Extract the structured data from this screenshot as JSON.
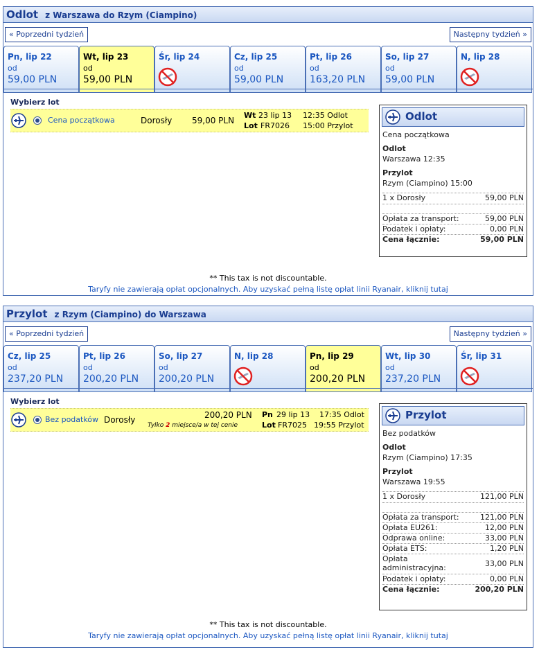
{
  "outbound": {
    "title": "Odlot",
    "route": "z Warszawa do Rzym (Ciampino)",
    "prev_week": "« Poprzedni tydzień",
    "next_week": "Następny tydzień »",
    "days": [
      {
        "name": "Pn, lip 22",
        "od": "od",
        "price": "59,00 PLN",
        "available": true,
        "selected": false
      },
      {
        "name": "Wt, lip 23",
        "od": "od",
        "price": "59,00 PLN",
        "available": true,
        "selected": true
      },
      {
        "name": "Śr, lip 24",
        "od": "",
        "price": "",
        "available": false,
        "selected": false
      },
      {
        "name": "Cz, lip 25",
        "od": "od",
        "price": "59,00 PLN",
        "available": true,
        "selected": false
      },
      {
        "name": "Pt, lip 26",
        "od": "od",
        "price": "163,20 PLN",
        "available": true,
        "selected": false
      },
      {
        "name": "So, lip 27",
        "od": "od",
        "price": "59,00 PLN",
        "available": true,
        "selected": false
      },
      {
        "name": "N, lip 28",
        "od": "",
        "price": "",
        "available": false,
        "selected": false
      }
    ],
    "choose_label": "Wybierz lot",
    "flight": {
      "fare": "Cena początkowa",
      "passenger": "Dorosły",
      "price": "59,00 PLN",
      "day_label": "Wt",
      "date": "23 lip 13",
      "lot_label": "Lot",
      "flight_no": "FR7026",
      "depart": "12:35 Odlot",
      "arrive": "15:00 Przylot"
    },
    "summary": {
      "title": "Odlot",
      "fare": "Cena początkowa",
      "dep_label": "Odlot",
      "dep_value": "Warszawa 12:35",
      "arr_label": "Przylot",
      "arr_value": "Rzym (Ciampino) 15:00",
      "pax": {
        "label": "1 x Dorosły",
        "value": "59,00 PLN"
      },
      "fees": [
        {
          "label": "Opłata za transport:",
          "value": "59,00 PLN"
        },
        {
          "label": "Podatek i opłaty:",
          "value": "0,00 PLN"
        }
      ],
      "total": {
        "label": "Cena łącznie:",
        "value": "59,00 PLN"
      }
    },
    "note": "** This tax is not discountable.",
    "link": "Taryfy nie zawierają opłat opcjonalnych. Aby uzyskać pełną listę opłat linii Ryanair, kliknij tutaj"
  },
  "inbound": {
    "title": "Przylot",
    "route": "z Rzym (Ciampino) do Warszawa",
    "prev_week": "« Poprzedni tydzień",
    "next_week": "Następny tydzień »",
    "days": [
      {
        "name": "Cz, lip 25",
        "od": "od",
        "price": "237,20 PLN",
        "available": true,
        "selected": false
      },
      {
        "name": "Pt, lip 26",
        "od": "od",
        "price": "200,20 PLN",
        "available": true,
        "selected": false
      },
      {
        "name": "So, lip 27",
        "od": "od",
        "price": "200,20 PLN",
        "available": true,
        "selected": false
      },
      {
        "name": "N, lip 28",
        "od": "",
        "price": "",
        "available": false,
        "selected": false
      },
      {
        "name": "Pn, lip 29",
        "od": "od",
        "price": "200,20 PLN",
        "available": true,
        "selected": true
      },
      {
        "name": "Wt, lip 30",
        "od": "od",
        "price": "237,20 PLN",
        "available": true,
        "selected": false
      },
      {
        "name": "Śr, lip 31",
        "od": "",
        "price": "",
        "available": false,
        "selected": false
      }
    ],
    "choose_label": "Wybierz lot",
    "flight": {
      "fare": "Bez podatków",
      "passenger": "Dorosły",
      "price": "200,20 PLN",
      "seats_pre": "Tylko",
      "seats_num": "2",
      "seats_post": "miejsce/a w tej cenie",
      "day_label": "Pn",
      "date": "29 lip 13",
      "lot_label": "Lot",
      "flight_no": "FR7025",
      "depart": "17:35 Odlot",
      "arrive": "19:55 Przylot"
    },
    "summary": {
      "title": "Przylot",
      "fare": "Bez podatków",
      "dep_label": "Odlot",
      "dep_value": "Rzym (Ciampino) 17:35",
      "arr_label": "Przylot",
      "arr_value": "Warszawa 19:55",
      "pax": {
        "label": "1 x Dorosły",
        "value": "121,00 PLN"
      },
      "fees": [
        {
          "label": "Opłata za transport:",
          "value": "121,00 PLN"
        },
        {
          "label": "Opłata EU261:",
          "value": "12,00 PLN"
        },
        {
          "label": "Odprawa online:",
          "value": "33,00 PLN"
        },
        {
          "label": "Opłata ETS:",
          "value": "1,20 PLN"
        },
        {
          "label": "Opłata administracyjna:",
          "value": "33,00 PLN"
        },
        {
          "label": "Podatek i opłaty:",
          "value": "0,00 PLN"
        }
      ],
      "total": {
        "label": "Cena łącznie:",
        "value": "200,20 PLN"
      }
    },
    "note": "** This tax is not discountable.",
    "link": "Taryfy nie zawierają opłat opcjonalnych. Aby uzyskać pełną listę opłat linii Ryanair, kliknij tutaj"
  }
}
